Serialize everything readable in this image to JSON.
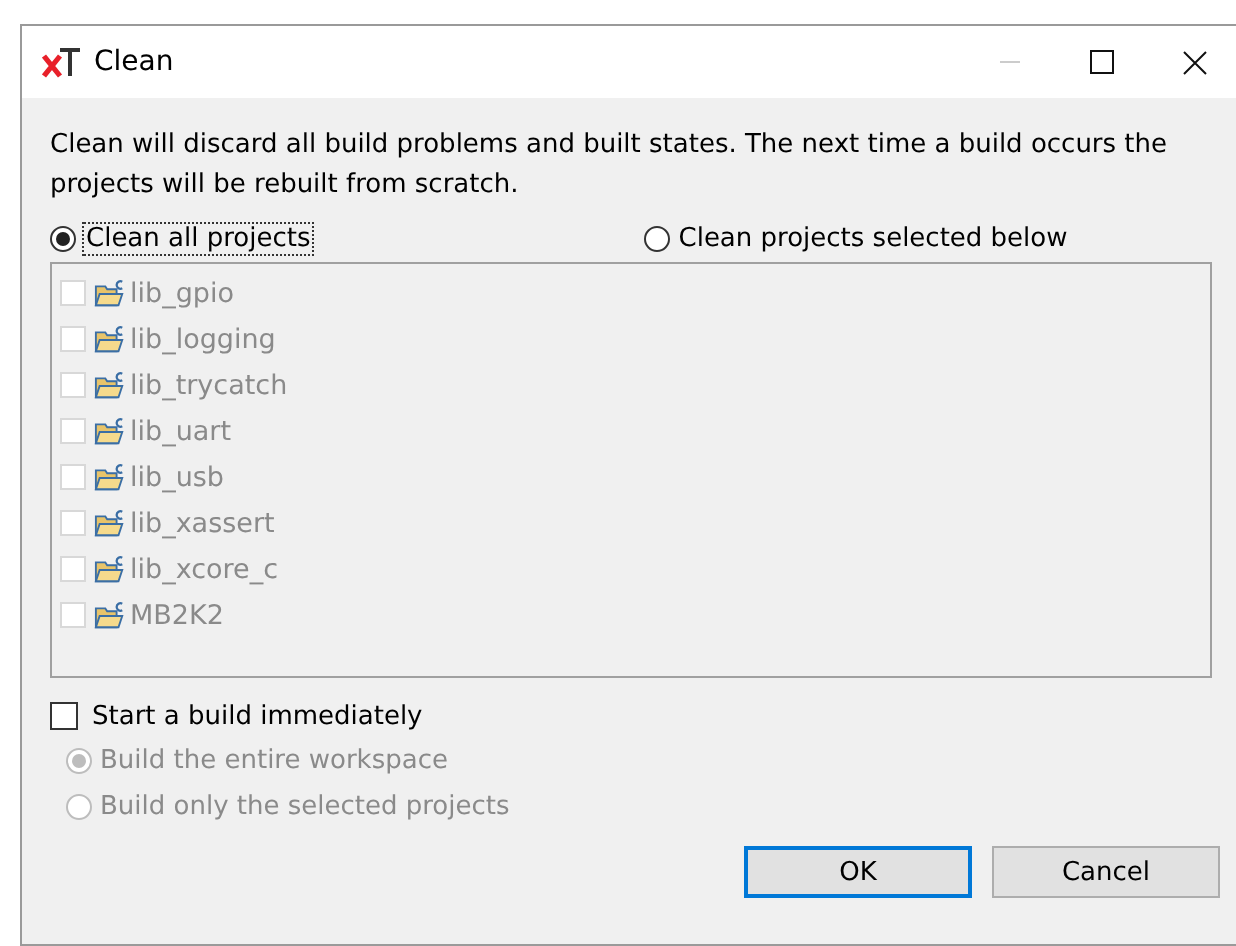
{
  "window": {
    "title": "Clean"
  },
  "description": "Clean will discard all build problems and built states.  The next time a build occurs the projects will be rebuilt from scratch.",
  "scope_options": [
    {
      "label": "Clean all projects",
      "selected": true,
      "focused": true
    },
    {
      "label": "Clean projects selected below",
      "selected": false,
      "focused": false
    }
  ],
  "projects": {
    "disabled": true,
    "items": [
      {
        "name": "lib_gpio",
        "checked": false
      },
      {
        "name": "lib_logging",
        "checked": false
      },
      {
        "name": "lib_trycatch",
        "checked": false
      },
      {
        "name": "lib_uart",
        "checked": false
      },
      {
        "name": "lib_usb",
        "checked": false
      },
      {
        "name": "lib_xassert",
        "checked": false
      },
      {
        "name": "lib_xcore_c",
        "checked": false
      },
      {
        "name": "MB2K2",
        "checked": false
      }
    ]
  },
  "start_build": {
    "label": "Start a build immediately",
    "checked": false
  },
  "build_options": {
    "disabled": true,
    "items": [
      {
        "label": "Build the entire workspace",
        "selected": true
      },
      {
        "label": "Build only the selected projects",
        "selected": false
      }
    ]
  },
  "buttons": [
    {
      "label": "OK",
      "default": true
    },
    {
      "label": "Cancel",
      "default": false
    }
  ]
}
